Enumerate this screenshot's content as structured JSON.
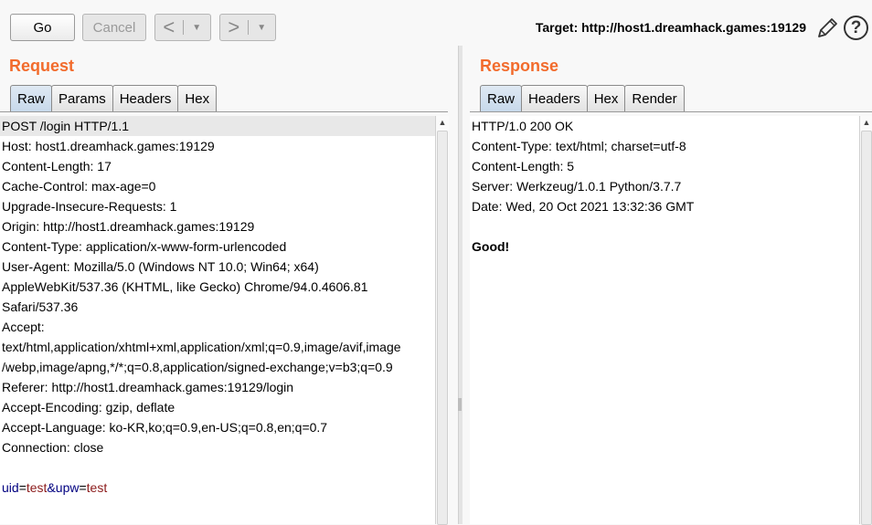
{
  "toolbar": {
    "go_label": "Go",
    "cancel_label": "Cancel",
    "back_symbol": "<",
    "forward_symbol": ">",
    "dropdown_symbol": "▼",
    "target_label": "Target: http://host1.dreamhack.games:19129",
    "help_symbol": "?"
  },
  "request": {
    "title": "Request",
    "tabs": [
      "Raw",
      "Params",
      "Headers",
      "Hex"
    ],
    "active_tab": "Raw",
    "lines": [
      "POST /login HTTP/1.1",
      "Host: host1.dreamhack.games:19129",
      "Content-Length: 17",
      "Cache-Control: max-age=0",
      "Upgrade-Insecure-Requests: 1",
      "Origin: http://host1.dreamhack.games:19129",
      "Content-Type: application/x-www-form-urlencoded",
      "User-Agent: Mozilla/5.0 (Windows NT 10.0; Win64; x64)",
      "AppleWebKit/537.36 (KHTML, like Gecko) Chrome/94.0.4606.81",
      "Safari/537.36",
      "Accept:",
      "text/html,application/xhtml+xml,application/xml;q=0.9,image/avif,image",
      "/webp,image/apng,*/*;q=0.8,application/signed-exchange;v=b3;q=0.9",
      "Referer: http://host1.dreamhack.games:19129/login",
      "Accept-Encoding: gzip, deflate",
      "Accept-Language: ko-KR,ko;q=0.9,en-US;q=0.8,en;q=0.7",
      "Connection: close",
      ""
    ],
    "body": {
      "p1_key": "uid",
      "eq1": "=",
      "p1_val": "test",
      "amp": "&",
      "p2_key": "upw",
      "eq2": "=",
      "p2_val": "test"
    }
  },
  "response": {
    "title": "Response",
    "tabs": [
      "Raw",
      "Headers",
      "Hex",
      "Render"
    ],
    "active_tab": "Raw",
    "lines": [
      "HTTP/1.0 200 OK",
      "Content-Type: text/html; charset=utf-8",
      "Content-Length: 5",
      "Server: Werkzeug/1.0.1 Python/3.7.7",
      "Date: Wed, 20 Oct 2021 13:32:36 GMT",
      ""
    ],
    "body": "Good!"
  },
  "scrollbar": {
    "up_symbol": "▲"
  }
}
